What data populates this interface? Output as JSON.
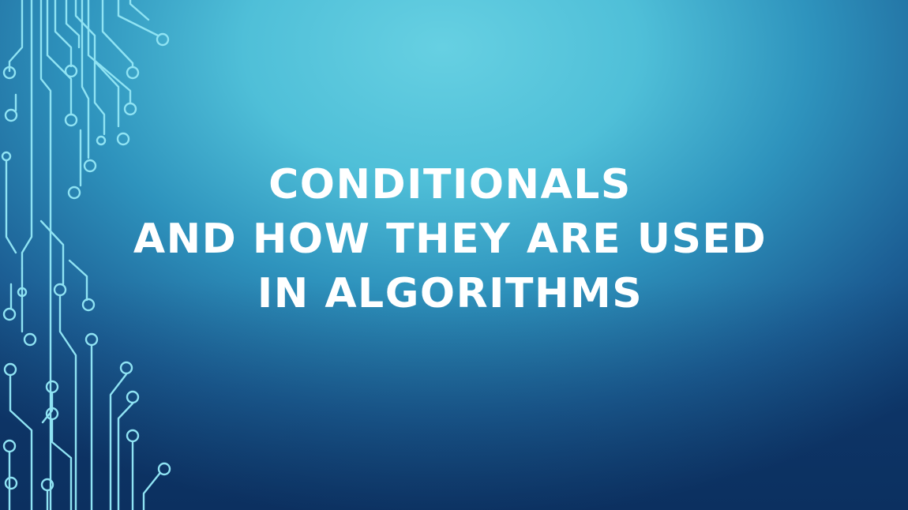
{
  "slide": {
    "title_lines": [
      "CONDITIONALS",
      "AND HOW THEY ARE USED",
      "IN ALGORITHMS"
    ]
  },
  "decoration": {
    "icon": "circuit-board-traces-icon",
    "trace_color": "#8fe3f3"
  },
  "colors": {
    "background_light": "#66d0e2",
    "background_dark": "#0f3a6e",
    "title_text": "#ffffff"
  }
}
